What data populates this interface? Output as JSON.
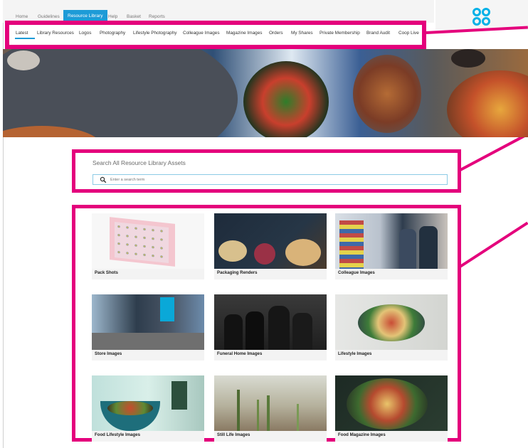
{
  "top_nav": {
    "items": [
      "Home",
      "Guidelines",
      "Resource Library",
      "Help",
      "Basket",
      "Reports"
    ],
    "active": "Resource Library"
  },
  "logo": {
    "name": "coop-logo",
    "color": "#00b1e7"
  },
  "sub_nav": {
    "items": [
      "Latest",
      "Library Resources",
      "Logos",
      "Photography",
      "Lifestyle Photography",
      "Colleague Images",
      "Magazine Images",
      "Orders",
      "My Shares",
      "Private Membership",
      "Brand Audit",
      "Coop Live"
    ],
    "active": "Latest"
  },
  "search": {
    "title": "Search All Resource Library Assets",
    "placeholder": "Enter a search term"
  },
  "gallery": {
    "cards": [
      {
        "label": "Pack Shots"
      },
      {
        "label": "Packaging Renders"
      },
      {
        "label": "Colleague Images"
      },
      {
        "label": "Store Images"
      },
      {
        "label": "Funeral Home Images"
      },
      {
        "label": "Lifestyle Images"
      },
      {
        "label": "Food Lifestyle Images"
      },
      {
        "label": "Still Life Images"
      },
      {
        "label": "Food Magazine Images"
      }
    ]
  },
  "colors": {
    "highlight": "#e4007c",
    "accent": "#1d9bd7"
  }
}
